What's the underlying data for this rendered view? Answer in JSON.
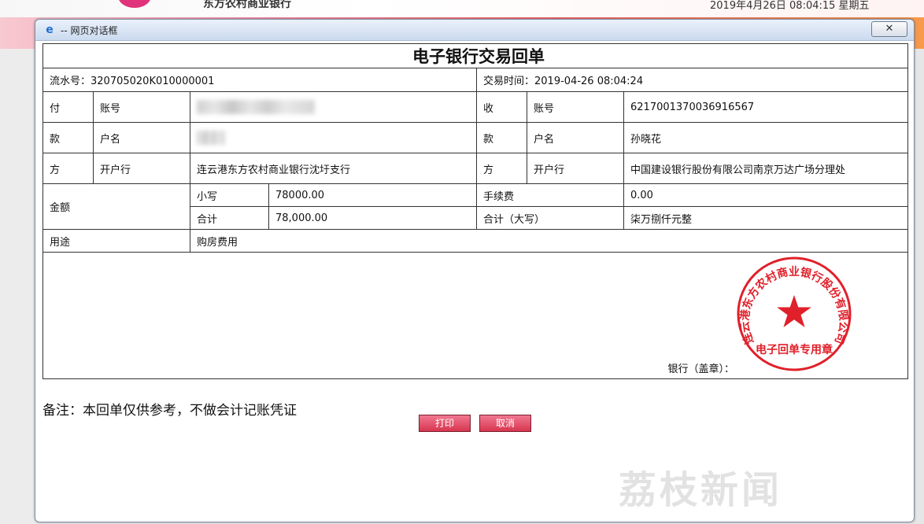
{
  "background": {
    "bank_name": "东方农村商业银行",
    "datetime": "2019年4月26日 08:04:15 星期五"
  },
  "window": {
    "title": "-- 网页对话框",
    "close_symbol": "✕"
  },
  "receipt": {
    "title": "电子银行交易回单",
    "serial_label": "流水号：",
    "serial_value": "320705020K010000001",
    "time_label": "交易时间：",
    "time_value": "2019-04-26 08:04:24",
    "payer": {
      "side_chars": [
        "付",
        "款",
        "方"
      ],
      "account_label": "账号",
      "name_label": "户名",
      "bank_label": "开户行",
      "bank_value": "连云港东方农村商业银行沈圩支行"
    },
    "payee": {
      "side_chars": [
        "收",
        "款",
        "方"
      ],
      "account_label": "账号",
      "account_value": "6217001370036916567",
      "name_label": "户名",
      "name_value": "孙晓花",
      "bank_label": "开户行",
      "bank_value": "中国建设银行股份有限公司南京万达广场分理处"
    },
    "amount_label": "金额",
    "lowercase_label": "小写",
    "lowercase_value": "78000.00",
    "fee_label": "手续费",
    "fee_value": "0.00",
    "total_label": "合计",
    "total_value": "78,000.00",
    "total_upper_label": "合计（大写）",
    "total_upper_value": "柒万捌仟元整",
    "purpose_label": "用途",
    "purpose_value": "购房费用",
    "stamp_label": "银行（盖章）：",
    "stamp_ring_text": "连云港东方农村商业银行股份有限公司",
    "stamp_bottom_text": "电子回单专用章",
    "note": "备注：本回单仅供参考，不做会计记账凭证"
  },
  "buttons": {
    "print": "打印",
    "cancel": "取消"
  },
  "watermark": "荔枝新闻",
  "colors": {
    "button": "#d8354f",
    "stamp": "#e0202a"
  }
}
